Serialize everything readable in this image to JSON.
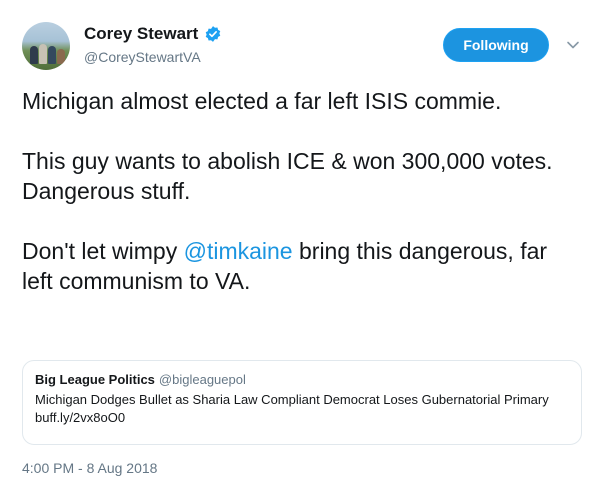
{
  "author": {
    "display_name": "Corey Stewart",
    "handle": "@CoreyStewartVA",
    "verified_icon": "verified-badge-icon"
  },
  "follow_button": {
    "label": "Following"
  },
  "caret_icon": "chevron-down-icon",
  "tweet": {
    "para1": "Michigan almost elected a far left ISIS commie.",
    "para2": "This guy wants to abolish ICE & won 300,000 votes. Dangerous stuff.",
    "para3_before": "Don't let wimpy ",
    "para3_mention": "@timkaine",
    "para3_after": " bring this dangerous, far left communism to VA."
  },
  "quote": {
    "name": "Big League Politics",
    "handle": "@bigleaguepol",
    "text": "Michigan Dodges Bullet as Sharia Law Compliant Democrat Loses Gubernatorial Primary buff.ly/2vx8oO0"
  },
  "timestamp": "4:00 PM - 8 Aug 2018",
  "colors": {
    "accent": "#1da1f2",
    "link": "#1b95e0",
    "muted": "#657786",
    "border": "#e1e8ed"
  }
}
